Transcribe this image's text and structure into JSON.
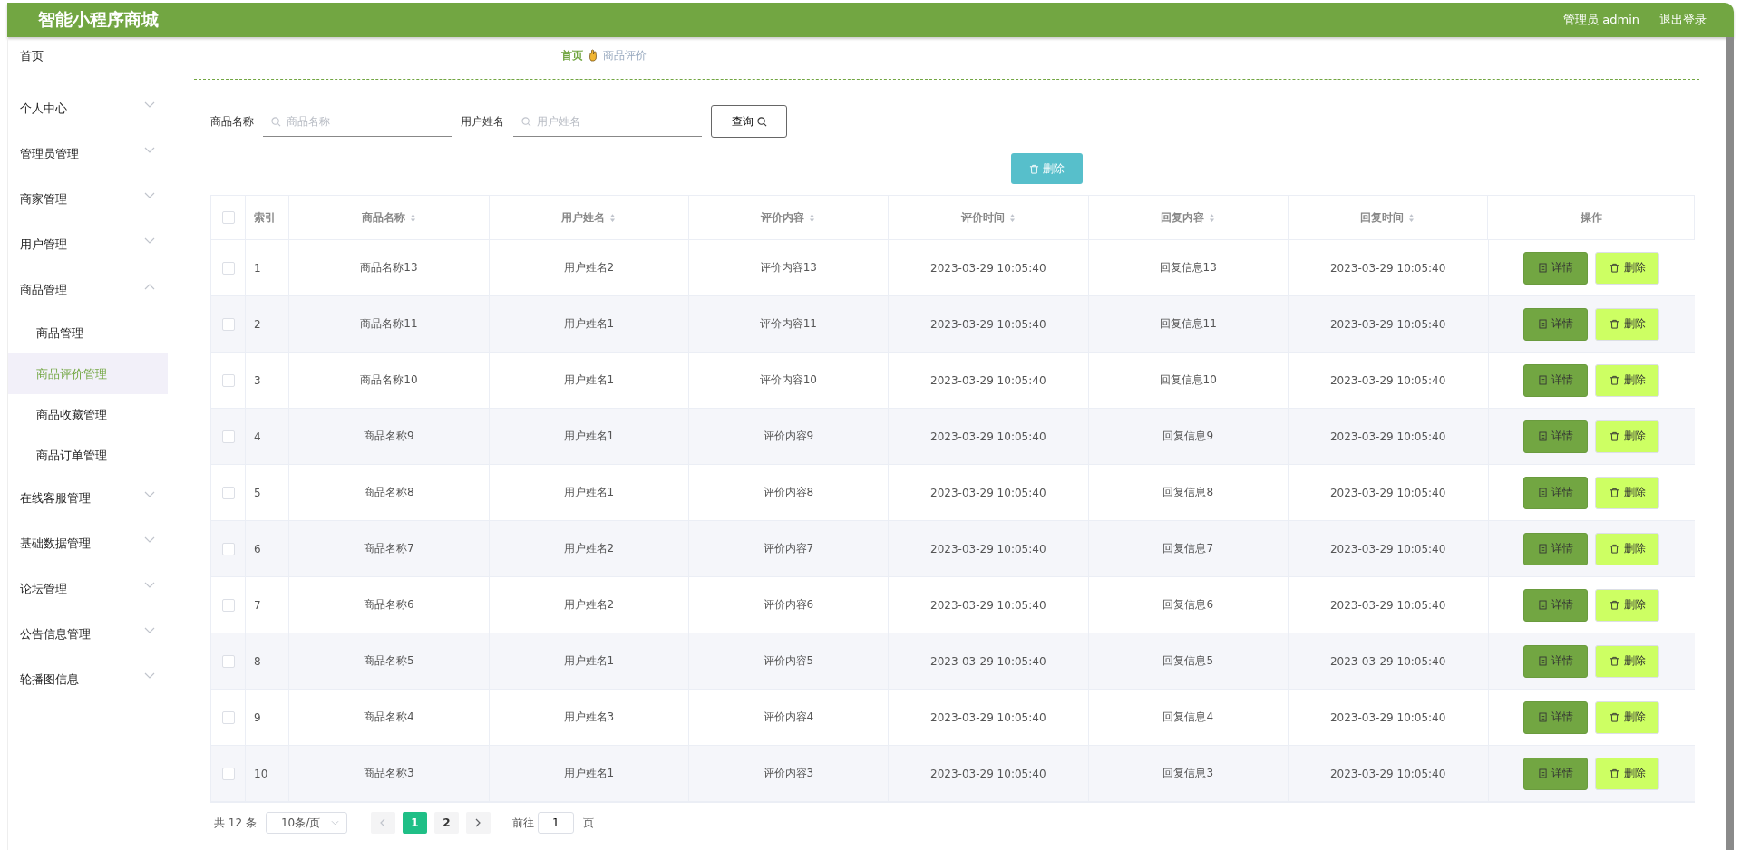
{
  "header": {
    "title": "智能小程序商城",
    "user": "管理员 admin",
    "logout": "退出登录"
  },
  "sidebar": {
    "items": [
      {
        "label": "首页",
        "kind": "link",
        "selected": false
      },
      {
        "label": "个人中心",
        "kind": "group",
        "expanded": false,
        "selected": false
      },
      {
        "label": "管理员管理",
        "kind": "group",
        "expanded": false,
        "selected": false
      },
      {
        "label": "商家管理",
        "kind": "group",
        "expanded": false,
        "selected": false
      },
      {
        "label": "用户管理",
        "kind": "group",
        "expanded": false,
        "selected": false
      },
      {
        "label": "商品管理",
        "kind": "group",
        "expanded": true,
        "selected": false,
        "children": [
          {
            "label": "商品管理",
            "selected": false
          },
          {
            "label": "商品评价管理",
            "selected": true
          },
          {
            "label": "商品收藏管理",
            "selected": false
          },
          {
            "label": "商品订单管理",
            "selected": false
          }
        ]
      },
      {
        "label": "在线客服管理",
        "kind": "group",
        "expanded": false,
        "selected": false
      },
      {
        "label": "基础数据管理",
        "kind": "group",
        "expanded": false,
        "selected": false
      },
      {
        "label": "论坛管理",
        "kind": "group",
        "expanded": false,
        "selected": false
      },
      {
        "label": "公告信息管理",
        "kind": "group",
        "expanded": false,
        "selected": false
      },
      {
        "label": "轮播图信息",
        "kind": "group",
        "expanded": false,
        "selected": false
      }
    ]
  },
  "breadcrumb": [
    "首页",
    "商品评价"
  ],
  "search": {
    "fields": [
      {
        "label": "商品名称",
        "placeholder": "商品名称"
      },
      {
        "label": "用户姓名",
        "placeholder": "用户姓名"
      }
    ],
    "button": "查询"
  },
  "delete_button": "删除",
  "table": {
    "select_all": {
      "checked": false
    },
    "columns": [
      {
        "label": "索引",
        "sortable": false
      },
      {
        "label": "商品名称",
        "sortable": true
      },
      {
        "label": "用户姓名",
        "sortable": true
      },
      {
        "label": "评价内容",
        "sortable": true
      },
      {
        "label": "评价时间",
        "sortable": true
      },
      {
        "label": "回复内容",
        "sortable": true
      },
      {
        "label": "回复时间",
        "sortable": true
      },
      {
        "label": "操作",
        "sortable": false
      }
    ],
    "rows": [
      {
        "checked": false,
        "cells": [
          "1",
          "商品名称13",
          "用户姓名2",
          "评价内容13",
          "2023-03-29 10:05:40",
          "回复信息13",
          "2023-03-29 10:05:40"
        ]
      },
      {
        "checked": false,
        "cells": [
          "2",
          "商品名称11",
          "用户姓名1",
          "评价内容11",
          "2023-03-29 10:05:40",
          "回复信息11",
          "2023-03-29 10:05:40"
        ]
      },
      {
        "checked": false,
        "cells": [
          "3",
          "商品名称10",
          "用户姓名1",
          "评价内容10",
          "2023-03-29 10:05:40",
          "回复信息10",
          "2023-03-29 10:05:40"
        ]
      },
      {
        "checked": false,
        "cells": [
          "4",
          "商品名称9",
          "用户姓名1",
          "评价内容9",
          "2023-03-29 10:05:40",
          "回复信息9",
          "2023-03-29 10:05:40"
        ]
      },
      {
        "checked": false,
        "cells": [
          "5",
          "商品名称8",
          "用户姓名1",
          "评价内容8",
          "2023-03-29 10:05:40",
          "回复信息8",
          "2023-03-29 10:05:40"
        ]
      },
      {
        "checked": false,
        "cells": [
          "6",
          "商品名称7",
          "用户姓名2",
          "评价内容7",
          "2023-03-29 10:05:40",
          "回复信息7",
          "2023-03-29 10:05:40"
        ]
      },
      {
        "checked": false,
        "cells": [
          "7",
          "商品名称6",
          "用户姓名2",
          "评价内容6",
          "2023-03-29 10:05:40",
          "回复信息6",
          "2023-03-29 10:05:40"
        ]
      },
      {
        "checked": false,
        "cells": [
          "8",
          "商品名称5",
          "用户姓名1",
          "评价内容5",
          "2023-03-29 10:05:40",
          "回复信息5",
          "2023-03-29 10:05:40"
        ]
      },
      {
        "checked": false,
        "cells": [
          "9",
          "商品名称4",
          "用户姓名3",
          "评价内容4",
          "2023-03-29 10:05:40",
          "回复信息4",
          "2023-03-29 10:05:40"
        ]
      },
      {
        "checked": false,
        "cells": [
          "10",
          "商品名称3",
          "用户姓名1",
          "评价内容3",
          "2023-03-29 10:05:40",
          "回复信息3",
          "2023-03-29 10:05:40"
        ]
      }
    ],
    "actions": [
      [
        "详情",
        "删除"
      ],
      [
        "详情",
        "删除"
      ],
      [
        "详情",
        "删除"
      ],
      [
        "详情",
        "删除"
      ],
      [
        "详情",
        "删除"
      ],
      [
        "详情",
        "删除"
      ],
      [
        "详情",
        "删除"
      ],
      [
        "详情",
        "删除"
      ],
      [
        "详情",
        "删除"
      ],
      [
        "详情",
        "删除"
      ]
    ]
  },
  "pagination": {
    "total": "共 12 条",
    "page_size": "10条/页",
    "pages": [
      {
        "label": "1",
        "selected": true
      },
      {
        "label": "2",
        "selected": false
      }
    ],
    "goto_label": "前往",
    "goto_value": "1",
    "goto_suffix": "页"
  }
}
